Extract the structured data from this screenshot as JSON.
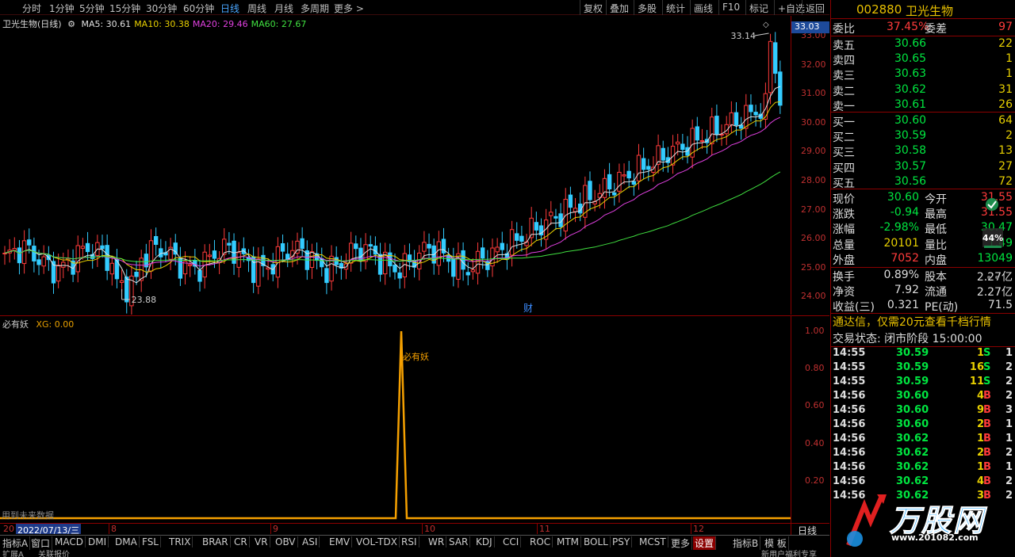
{
  "toolbar": {
    "periods": [
      "分时",
      "1分钟",
      "5分钟",
      "15分钟",
      "30分钟",
      "60分钟",
      "日线",
      "周线",
      "月线",
      "多周期",
      "更多 >"
    ],
    "active_period": "日线",
    "tools": [
      "复权",
      "叠加",
      "多股",
      "统计",
      "画线",
      "F10",
      "标记",
      "+自选",
      "返回"
    ]
  },
  "main_chart": {
    "title": "卫光生物(日线)",
    "ma": [
      {
        "label": "MA5: 30.61",
        "color": "#e0e0e0"
      },
      {
        "label": "MA10: 30.38",
        "color": "#e8d000"
      },
      {
        "label": "MA20: 29.46",
        "color": "#e040e0"
      },
      {
        "label": "MA60: 27.67",
        "color": "#40e040"
      }
    ],
    "last_price": "33.03",
    "high_label": "33.14",
    "low_label": "23.88",
    "finance_marker": "财",
    "y_ticks": [
      "33.00",
      "32.00",
      "31.00",
      "30.00",
      "29.00",
      "28.00",
      "27.00",
      "26.00",
      "25.00",
      "24.00"
    ]
  },
  "indicator": {
    "title": "必有妖",
    "value_label": "XG: 0.00",
    "signal_label": "必有妖",
    "y_ticks": [
      "1.00",
      "0.80",
      "0.60",
      "0.40",
      "0.20"
    ],
    "footnote": "用到未来数据"
  },
  "date_axis": {
    "cursor_date": "2022/07/13/三",
    "left_fragment": "20",
    "months": [
      "8",
      "9",
      "10",
      "11",
      "12"
    ],
    "period": "日线"
  },
  "indicator_tabs": {
    "tabs": [
      "指标A",
      "窗口",
      "MACD",
      "DMI",
      "DMA",
      "FSL",
      "TRIX",
      "BRAR",
      "CR",
      "VR",
      "OBV",
      "ASI",
      "EMV",
      "VOL-TDX",
      "RSI",
      "WR",
      "SAR",
      "KDJ",
      "CCI",
      "ROC",
      "MTM",
      "BOLL",
      "PSY",
      "MCST",
      "更多",
      "设置"
    ],
    "active": "设置",
    "right_tabs": [
      "指标B",
      "模 板"
    ]
  },
  "status_row": {
    "left": "扩展A",
    "mid": "关联报价",
    "right": "新用户福利专享"
  },
  "quote": {
    "code": "002880",
    "name": "卫光生物",
    "weibi_label": "委比",
    "weibi_value": "37.45%",
    "weicha_label": "委差",
    "weicha_value": "97",
    "asks": [
      {
        "label": "卖五",
        "price": "30.66",
        "vol": "22"
      },
      {
        "label": "卖四",
        "price": "30.65",
        "vol": "1"
      },
      {
        "label": "卖三",
        "price": "30.63",
        "vol": "1"
      },
      {
        "label": "卖二",
        "price": "30.62",
        "vol": "31"
      },
      {
        "label": "卖一",
        "price": "30.61",
        "vol": "26"
      }
    ],
    "bids": [
      {
        "label": "买一",
        "price": "30.60",
        "vol": "64"
      },
      {
        "label": "买二",
        "price": "30.59",
        "vol": "2"
      },
      {
        "label": "买三",
        "price": "30.58",
        "vol": "13"
      },
      {
        "label": "买四",
        "price": "30.57",
        "vol": "27"
      },
      {
        "label": "买五",
        "price": "30.56",
        "vol": "72"
      }
    ],
    "stats": [
      {
        "l1": "现价",
        "v1": "30.60",
        "c1": "green",
        "l2": "今开",
        "v2": "31.55",
        "c2": "red"
      },
      {
        "l1": "涨跌",
        "v1": "-0.94",
        "c1": "green",
        "l2": "最高",
        "v2": "31.55",
        "c2": "red"
      },
      {
        "l1": "涨幅",
        "v1": "-2.98%",
        "c1": "green",
        "l2": "最低",
        "v2": "30.47",
        "c2": "green"
      },
      {
        "l1": "总量",
        "v1": "20101",
        "c1": "yellow",
        "l2": "量比",
        "v2": "1.49",
        "c2": "green"
      },
      {
        "l1": "外盘",
        "v1": "7052",
        "c1": "red",
        "l2": "内盘",
        "v2": "13049",
        "c2": "green"
      }
    ],
    "fund": [
      {
        "l1": "换手",
        "v1": "0.89%",
        "l2": "股本",
        "v2": "2.27亿"
      },
      {
        "l1": "净资",
        "v1": "7.92",
        "l2": "流通",
        "v2": "2.27亿"
      },
      {
        "l1": "收益(三)",
        "v1": "0.321",
        "l2": "PE(动)",
        "v2": "71.5"
      }
    ],
    "notice": "通达信，仅需20元查看千档行情",
    "trade_state": "交易状态: 闭市阶段 15:00:00",
    "ticks": [
      {
        "t": "14:55",
        "p": "30.59",
        "v": "1",
        "bs": "S",
        "n": "1"
      },
      {
        "t": "14:55",
        "p": "30.59",
        "v": "16",
        "bs": "S",
        "n": "2"
      },
      {
        "t": "14:55",
        "p": "30.59",
        "v": "11",
        "bs": "S",
        "n": "2"
      },
      {
        "t": "14:56",
        "p": "30.60",
        "v": "4",
        "bs": "B",
        "n": "2"
      },
      {
        "t": "14:56",
        "p": "30.60",
        "v": "9",
        "bs": "B",
        "n": "3"
      },
      {
        "t": "14:56",
        "p": "30.60",
        "v": "2",
        "bs": "B",
        "n": "1"
      },
      {
        "t": "14:56",
        "p": "30.62",
        "v": "1",
        "bs": "B",
        "n": "1"
      },
      {
        "t": "14:56",
        "p": "30.62",
        "v": "2",
        "bs": "B",
        "n": "2"
      },
      {
        "t": "14:56",
        "p": "30.62",
        "v": "1",
        "bs": "B",
        "n": "1"
      },
      {
        "t": "14:56",
        "p": "30.62",
        "v": "4",
        "bs": "B",
        "n": "2"
      },
      {
        "t": "14:56",
        "p": "30.62",
        "v": "3",
        "bs": "B",
        "n": "2"
      }
    ],
    "badge_pct": "44%"
  },
  "watermark": {
    "text": "万股网",
    "url": "www.201082.com"
  }
}
